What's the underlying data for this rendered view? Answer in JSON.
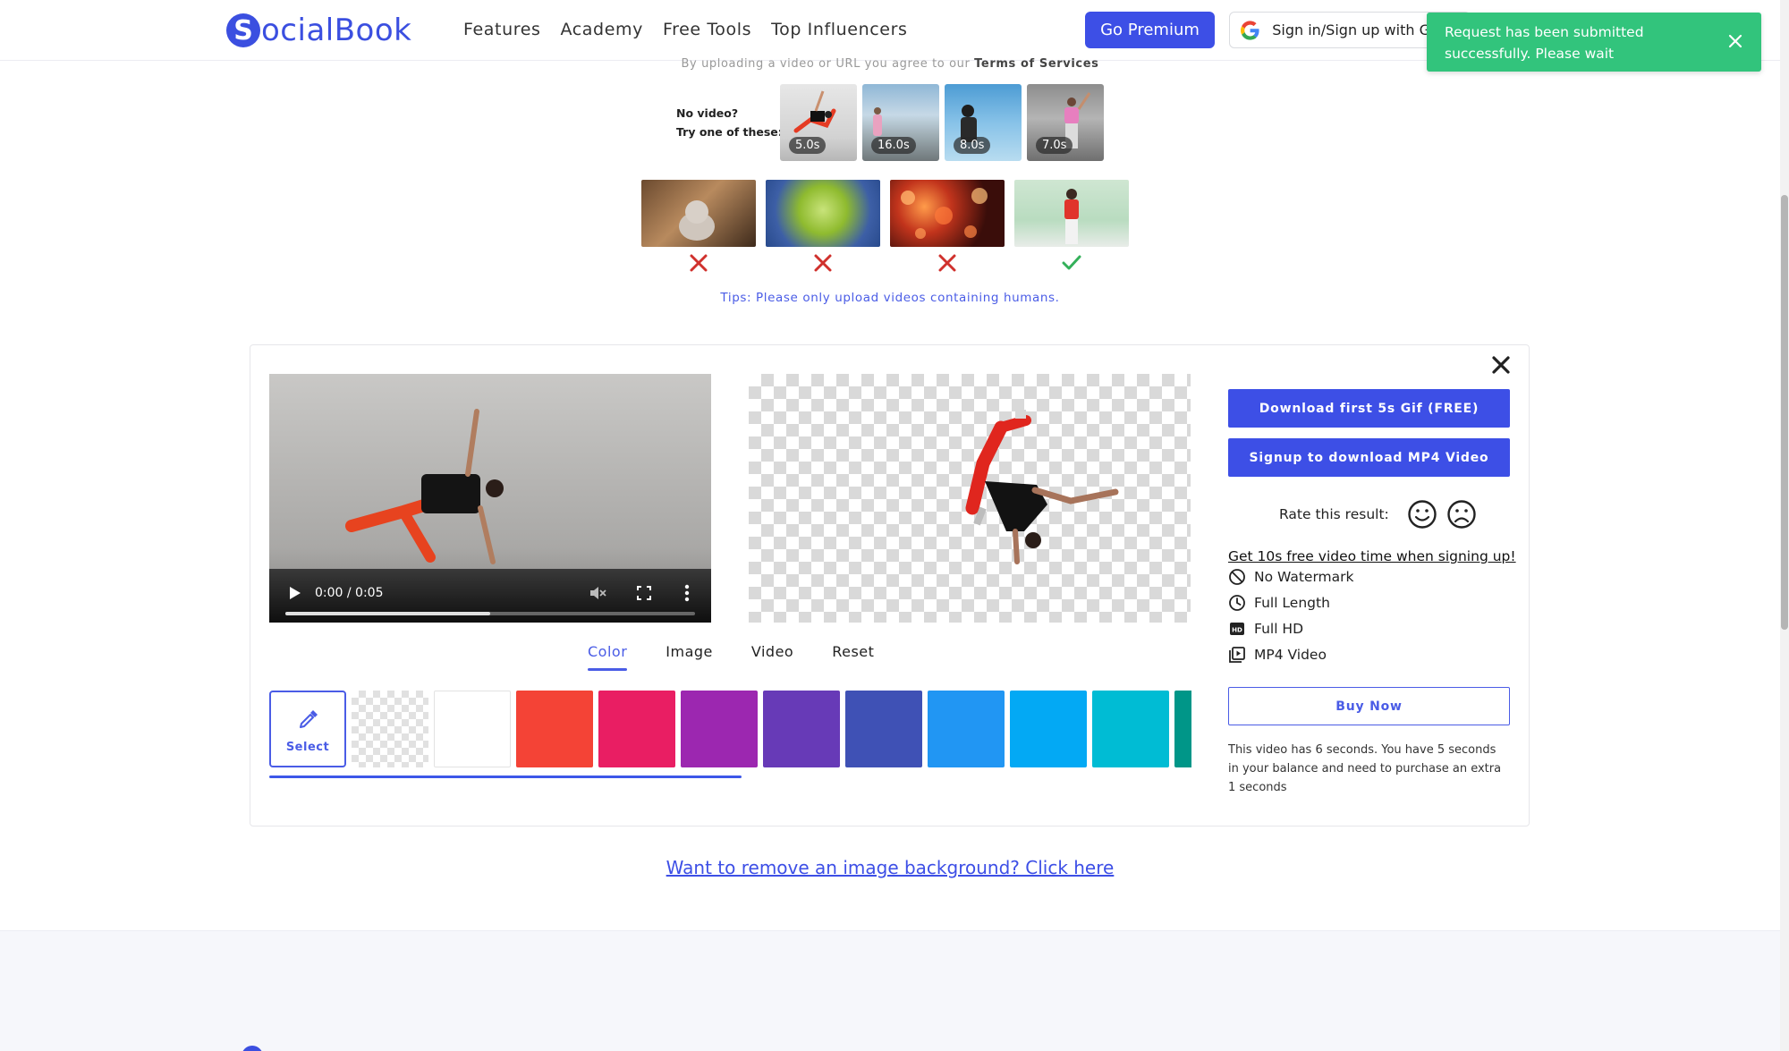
{
  "brand": {
    "logo_letter": "S",
    "logo_text": "ocialBook",
    "color": "#3b4fe0"
  },
  "nav": {
    "items": [
      "Features",
      "Academy",
      "Free Tools",
      "Top Influencers"
    ]
  },
  "header": {
    "premium_label": "Go Premium",
    "google_label": "Sign in/Sign up with Google"
  },
  "toast": {
    "message": "Request has been submitted successfully. Please wait",
    "color": "#32c47c"
  },
  "upload": {
    "terms_prefix": "By uploading a video or URL you agree to our",
    "terms_link": "Terms of Services",
    "no_video_line1": "No video?",
    "no_video_line2": "Try one of these:",
    "samples": [
      {
        "duration": "5.0s"
      },
      {
        "duration": "16.0s"
      },
      {
        "duration": "8.0s"
      },
      {
        "duration": "7.0s"
      }
    ],
    "examples": [
      "x-icon",
      "x-icon",
      "x-icon",
      "check-icon"
    ],
    "tips": "Tips: Please only upload videos containing humans."
  },
  "player": {
    "time": "0:00 / 0:05",
    "progress": 0.5
  },
  "tabs": {
    "items": [
      "Color",
      "Image",
      "Video",
      "Reset"
    ],
    "active": "Color"
  },
  "swatches": {
    "select_label": "Select",
    "colors": [
      "#f44336",
      "#e91e63",
      "#9c27b0",
      "#673ab7",
      "#3f51b5",
      "#2196f3",
      "#03a9f4",
      "#00bcd4",
      "#009688"
    ]
  },
  "side": {
    "download_gif": "Download first 5s Gif (FREE)",
    "signup_mp4": "Signup to download MP4 Video",
    "rate_label": "Rate this result:",
    "promo": "Get 10s free video time when signing up!",
    "features": [
      {
        "icon": "no-watermark-icon",
        "label": "No Watermark"
      },
      {
        "icon": "clock-icon",
        "label": "Full Length"
      },
      {
        "icon": "hd-icon",
        "label": "Full HD"
      },
      {
        "icon": "mp4-video-icon",
        "label": "MP4 Video"
      }
    ],
    "buy_label": "Buy Now",
    "note": "This video has 6 seconds. You have 5 seconds in your balance and need to purchase an extra 1 seconds"
  },
  "image_link": "Want to remove an image background? Click here"
}
